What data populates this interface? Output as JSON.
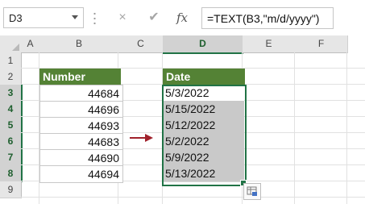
{
  "formula_bar": {
    "name_box": "D3",
    "cancel_icon": "×",
    "enter_icon": "✔",
    "fx_label": "fx",
    "formula": "=TEXT(B3,\"m/d/yyyy\")"
  },
  "columns": [
    "A",
    "B",
    "C",
    "D",
    "E",
    "F"
  ],
  "rows": [
    "1",
    "2",
    "3",
    "4",
    "5",
    "6",
    "7",
    "8",
    "9"
  ],
  "table_number": {
    "header": "Number",
    "values": [
      "44684",
      "44696",
      "44693",
      "44683",
      "44690",
      "44694"
    ]
  },
  "table_date": {
    "header": "Date",
    "values": [
      "5/3/2022",
      "5/15/2022",
      "5/12/2022",
      "5/2/2022",
      "5/9/2022",
      "5/13/2022"
    ]
  },
  "colors": {
    "header_green": "#548235",
    "selection_green": "#217346",
    "arrow_red": "#a0212b"
  },
  "icons": {
    "arrow": "right-arrow-icon",
    "quick_analysis": "quick-analysis-icon"
  }
}
